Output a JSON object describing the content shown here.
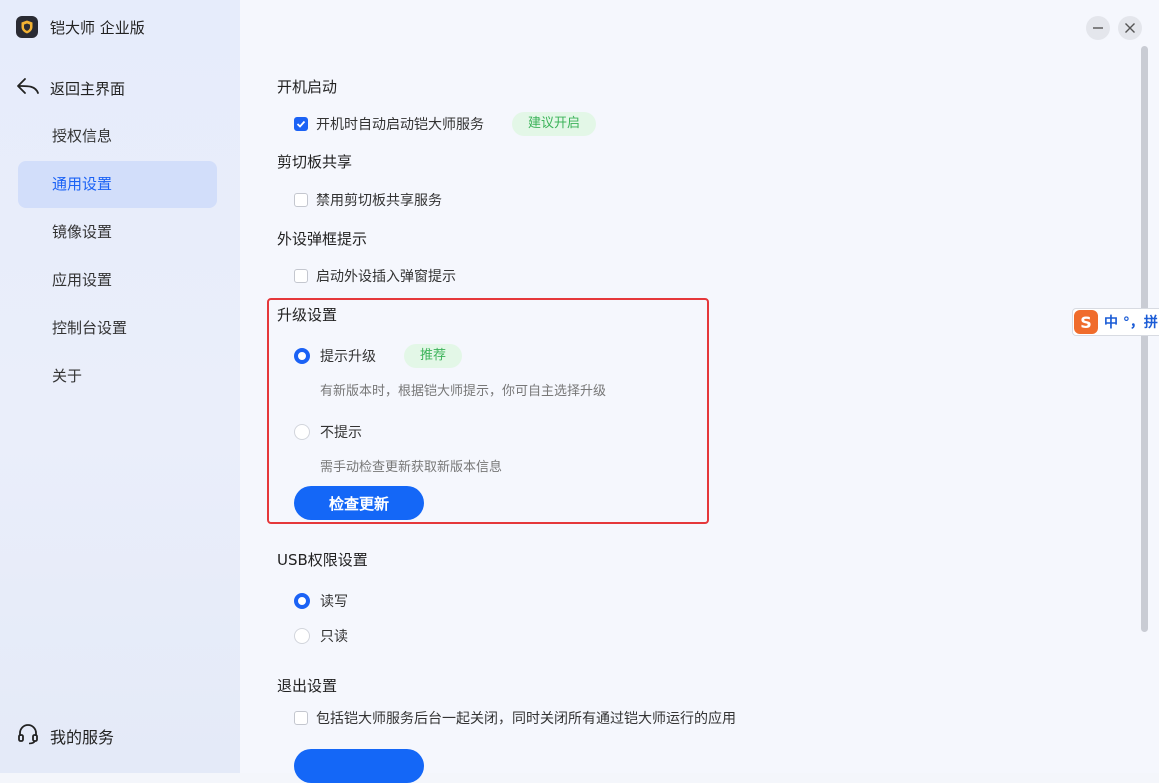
{
  "app": {
    "title": "铠大师 企业版",
    "logo_color": "#2a2b33",
    "accent": "#1b62f5"
  },
  "sidebar": {
    "back_label": "返回主界面",
    "items": [
      {
        "label": "授权信息",
        "active": false
      },
      {
        "label": "通用设置",
        "active": true
      },
      {
        "label": "镜像设置",
        "active": false
      },
      {
        "label": "应用设置",
        "active": false
      },
      {
        "label": "控制台设置",
        "active": false
      },
      {
        "label": "关于",
        "active": false
      }
    ],
    "service_label": "我的服务"
  },
  "window": {
    "minimize_icon": "minimize-icon",
    "close_icon": "close-icon"
  },
  "settings": {
    "startup": {
      "title": "开机启动",
      "option_label": "开机时自动启动铠大师服务",
      "checked": true,
      "badge": "建议开启"
    },
    "clipboard": {
      "title": "剪切板共享",
      "option_label": "禁用剪切板共享服务",
      "checked": false
    },
    "peripheral": {
      "title": "外设弹框提示",
      "option_label": "启动外设插入弹窗提示",
      "checked": false
    },
    "upgrade": {
      "title": "升级设置",
      "options": [
        {
          "label": "提示升级",
          "checked": true,
          "badge": "推荐",
          "desc": "有新版本时，根据铠大师提示，你可自主选择升级"
        },
        {
          "label": "不提示",
          "checked": false,
          "desc": "需手动检查更新获取新版本信息"
        }
      ],
      "button_label": "检查更新"
    },
    "usb": {
      "title": "USB权限设置",
      "options": [
        {
          "label": "读写",
          "checked": true
        },
        {
          "label": "只读",
          "checked": false
        }
      ]
    },
    "exit": {
      "title": "退出设置",
      "option_label": "包括铠大师服务后台一起关闭，同时关闭所有通过铠大师运行的应用",
      "checked": false
    }
  },
  "ime": {
    "logo": "S",
    "text": "中 °，拼"
  },
  "colors": {
    "highlight_border": "#e5383b",
    "badge_bg": "#e3f7e7",
    "badge_text": "#3cb35a",
    "primary_button": "#1467f7"
  }
}
